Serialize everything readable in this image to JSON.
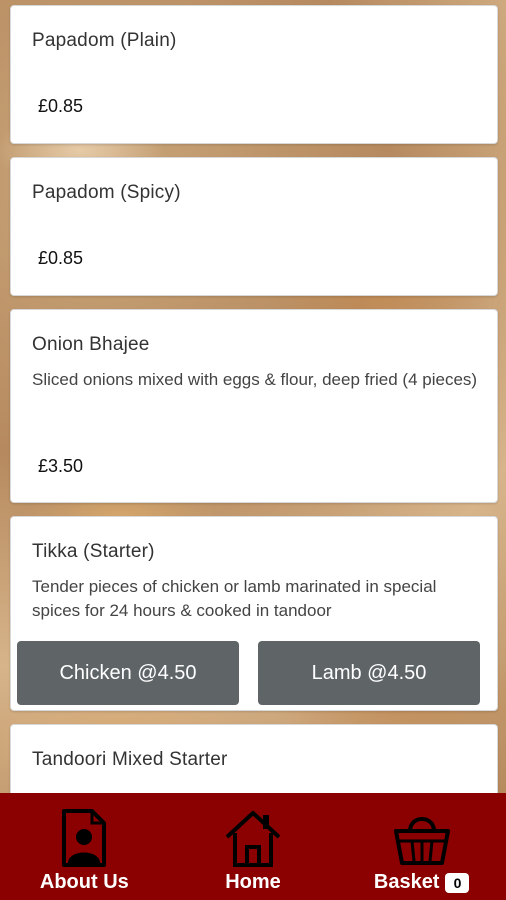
{
  "menu_items": [
    {
      "name": "Papadom (Plain)",
      "price": "£0.85"
    },
    {
      "name": "Papadom (Spicy)",
      "price": "£0.85"
    },
    {
      "name": "Onion Bhajee",
      "description": "Sliced onions mixed with eggs & flour, deep fried (4 pieces)",
      "price": "£3.50"
    },
    {
      "name": "Tikka (Starter)",
      "description": "Tender pieces of chicken or lamb marinated in special spices for 24 hours & cooked in tandoor",
      "options": [
        "Chicken @4.50",
        "Lamb @4.50"
      ]
    },
    {
      "name": "Tandoori Mixed Starter"
    }
  ],
  "nav": {
    "about": "About Us",
    "home": "Home",
    "basket": "Basket",
    "basket_count": "0"
  },
  "colors": {
    "nav_bg": "#8b0000",
    "option_button": "#5f6467"
  }
}
